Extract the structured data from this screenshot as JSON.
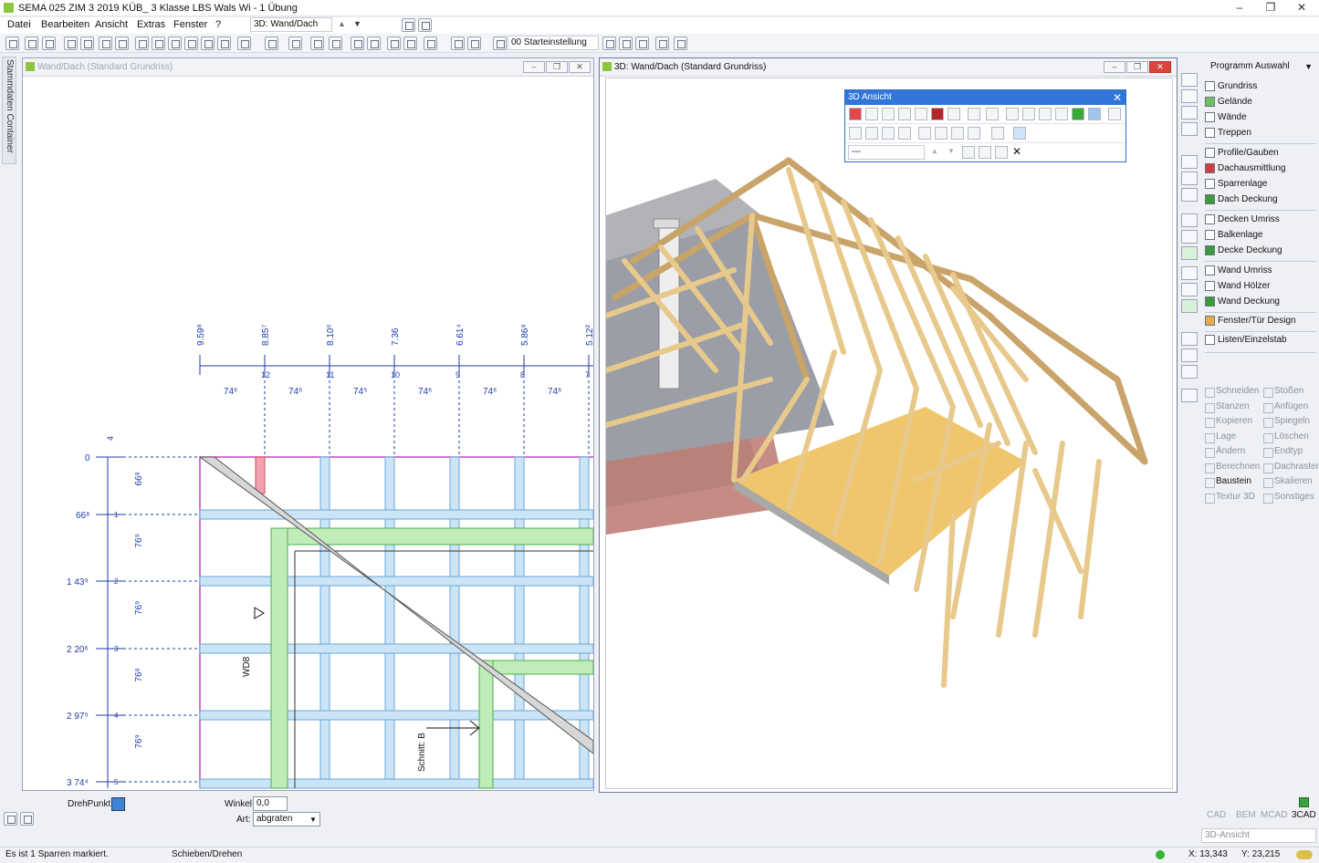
{
  "titlebar": {
    "title": "SEMA  025 ZIM 3 2019 KÜB_ 3 Klasse LBS Wals Wi - 1 Übung",
    "minimize": "–",
    "maximize": "❐",
    "close": "✕"
  },
  "menu": [
    "Datei",
    "Bearbeiten",
    "Ansicht",
    "Extras",
    "Fenster",
    "?"
  ],
  "view_select": "3D: Wand/Dach",
  "toolbar": {
    "preset_select": "00 Starteinstellung"
  },
  "left_tab": "Stammdaten Container",
  "plan_window": {
    "title": "Wand/Dach (Standard Grundriss)",
    "top_dims": [
      "9.59⁸",
      "8.85⁷",
      "8.10⁶",
      "7.36",
      "6.61⁴",
      "5.86⁸",
      "5.12²"
    ],
    "axis_labels": [
      "12",
      "11",
      "10",
      "9",
      "8",
      "7"
    ],
    "spacing": [
      "74⁶",
      "74⁶",
      "74⁵",
      "74⁶",
      "74⁶",
      "74⁶"
    ],
    "left_dims": [
      "0",
      "66⁸",
      "1 43⁹",
      "2 20⁶",
      "2 97⁵",
      "3 74⁴"
    ],
    "left_spacing": [
      "66⁸",
      "76⁹",
      "76⁹",
      "76⁸",
      "76⁹"
    ],
    "left_axis_labels": [
      "4",
      "1",
      "2",
      "3",
      "4",
      "5"
    ],
    "label_wd": "WD8",
    "label_schnitt": "Schnitt: B"
  },
  "view3d_window": {
    "title": "3D: Wand/Dach (Standard Grundriss)"
  },
  "popup3d": {
    "title": "3D Ansicht",
    "field": "---"
  },
  "right_panel": {
    "program_select": "Programm Auswahl",
    "groups": [
      [
        "Grundriss",
        "Gelände",
        "Wände",
        "Treppen"
      ],
      [
        "Profile/Gauben",
        "Dachausmittlung",
        "Sparrenlage",
        "Dach Deckung"
      ],
      [
        "Decken Umriss",
        "Balkenlage",
        "Decke Deckung"
      ],
      [
        "Wand Umriss",
        "Wand Hölzer",
        "Wand Deckung"
      ],
      [
        "Fenster/Tür Design"
      ],
      [
        "Listen/Einzelstab"
      ]
    ],
    "tools_left": [
      "Schneiden",
      "Stanzen",
      "Kopieren",
      "Lage",
      "Ändern",
      "Berechnen",
      "Baustein",
      "Textur 3D"
    ],
    "tools_right": [
      "Stoßen",
      "Anfügen",
      "Spiegeln",
      "Löschen",
      "Endtyp",
      "Dachraster",
      "Skalieren",
      "Sonstiges"
    ],
    "modules": [
      "CAD",
      "BEM",
      "MCAD",
      "3CAD"
    ],
    "view_select": "3D-Ansicht"
  },
  "bottom": {
    "drehpunkt_label": "DrehPunkt:",
    "winkel_label": "Winkel:",
    "winkel_value": "0,0",
    "art_label": "Art:",
    "art_value": "abgraten"
  },
  "status": {
    "message": "Es ist 1 Sparren markiert.",
    "mode": "Schieben/Drehen",
    "x": "X: 13,343",
    "y": "Y: 23,215"
  },
  "colors": {
    "accent": "#2f76d8",
    "wood": "#e8c98c",
    "wood_dark": "#c9a46a",
    "green": "#8fd68a",
    "blue_beam": "#a9d3f0",
    "magenta": "#c645c6"
  }
}
